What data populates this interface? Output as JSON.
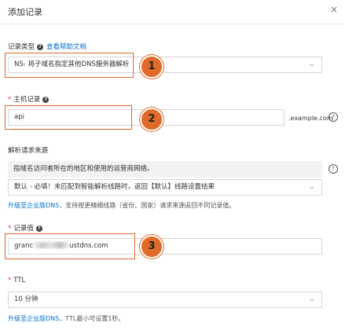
{
  "dialog": {
    "title": "添加记录",
    "close_glyph": "×"
  },
  "record_type": {
    "label": "记录类型",
    "help_link": "查看帮助文档",
    "value": "NS- 将子域名指定其他DNS服务器解析"
  },
  "host_record": {
    "label": "主机记录",
    "value": "api",
    "suffix": ".example.com"
  },
  "resolution_source": {
    "label": "解析请求来源",
    "hint": "指域名访问者所在的地区和使用的运营商网络。",
    "value": "默认 - 必填！未匹配到智能解析线路时，返回【默认】线路设置结果",
    "note_link": "升级至企业版DNS",
    "note_text": "，支持按更精细线路（省份、国家）请求来源返回不同记录值。"
  },
  "record_value": {
    "label": "记录值",
    "value_prefix": "granc",
    "value_suffix": "ustdns.com"
  },
  "ttl": {
    "label": "TTL",
    "value": "10 分钟",
    "note_link": "升级至企业版DNS",
    "note_text": "，TTL最小可设置1秒。"
  },
  "annotations": [
    "1",
    "2",
    "3"
  ],
  "icons": {
    "question": "?",
    "chevron": "chevron-down-icon",
    "close": "close-icon"
  },
  "colors": {
    "accent_link": "#0070cc",
    "annotation": "#e06a2a",
    "required": "#e0403a"
  }
}
